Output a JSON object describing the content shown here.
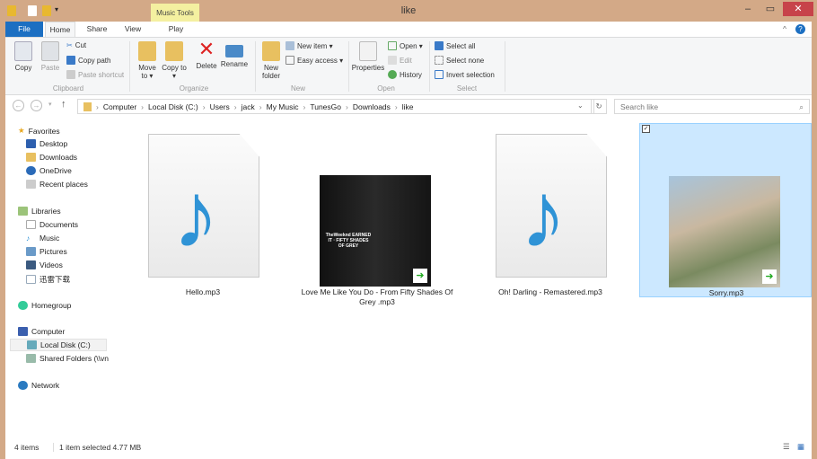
{
  "window": {
    "title": "like",
    "context_tab": "Music Tools",
    "minimize": "–",
    "maximize": "▭",
    "close": "✕"
  },
  "tabs": [
    "File",
    "Home",
    "Share",
    "View",
    "Play"
  ],
  "ribbon": {
    "clipboard": {
      "label": "Clipboard",
      "copy": "Copy",
      "paste": "Paste",
      "cut": "Cut",
      "copy_path": "Copy path",
      "paste_shortcut": "Paste shortcut"
    },
    "organize": {
      "label": "Organize",
      "move_to": "Move to ▾",
      "copy_to": "Copy to ▾",
      "delete": "Delete",
      "rename": "Rename"
    },
    "new": {
      "label": "New",
      "new_folder": "New folder",
      "new_item": "New item ▾",
      "easy_access": "Easy access ▾"
    },
    "open": {
      "label": "Open",
      "properties": "Properties",
      "open": "Open ▾",
      "edit": "Edit",
      "history": "History"
    },
    "select": {
      "label": "Select",
      "select_all": "Select all",
      "select_none": "Select none",
      "invert": "Invert selection"
    }
  },
  "address": {
    "crumbs": [
      "Computer",
      "Local Disk (C:)",
      "Users",
      "jack",
      "My Music",
      "TunesGo",
      "Downloads",
      "like"
    ],
    "search_placeholder": "Search like"
  },
  "sidebar": {
    "favorites": {
      "label": "Favorites",
      "items": [
        "Desktop",
        "Downloads",
        "OneDrive",
        "Recent places"
      ]
    },
    "libraries": {
      "label": "Libraries",
      "items": [
        "Documents",
        "Music",
        "Pictures",
        "Videos",
        "迅雷下载"
      ]
    },
    "homegroup": "Homegroup",
    "computer": {
      "label": "Computer",
      "items": [
        "Local Disk (C:)",
        "Shared Folders (\\\\vn"
      ]
    },
    "network": "Network"
  },
  "files": [
    {
      "name": "Hello.mp3"
    },
    {
      "name": "Love Me Like You Do - From  Fifty Shades Of Grey .mp3",
      "album_text": "TheWeeknd EARNED IT · FIFTY SHADES OF GREY"
    },
    {
      "name": "Oh! Darling - Remastered.mp3"
    },
    {
      "name": "Sorry.mp3"
    }
  ],
  "status": {
    "count": "4 items",
    "selected": "1 item selected  4.77 MB"
  }
}
